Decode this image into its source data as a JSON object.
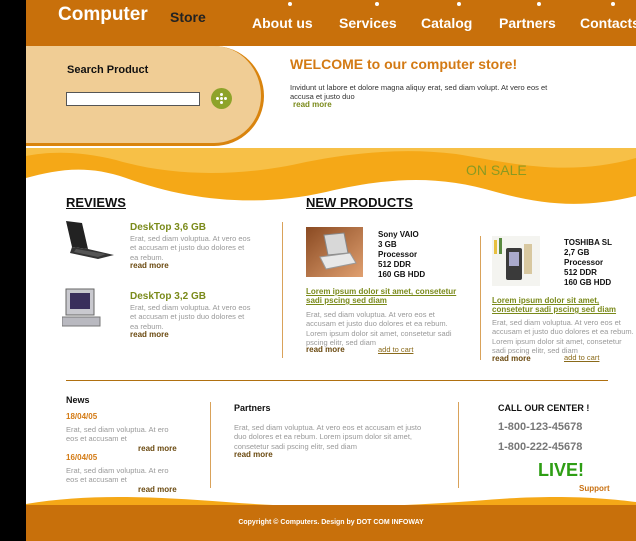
{
  "header": {
    "logo_main": "Computer",
    "logo_sub": "Store",
    "nav": [
      "About us",
      "Services",
      "Catalog",
      "Partners",
      "Contacts"
    ]
  },
  "search": {
    "label": "Search Product",
    "value": "",
    "go_icon": "arrow-go-icon"
  },
  "welcome": {
    "title": "WELCOME to our computer store!",
    "text": "Invidunt ut labore et dolore magna aliquy erat, sed diam volupt. At vero eos et accusa et justo duo",
    "read_more": "read more"
  },
  "on_sale": "ON SALE",
  "reviews": {
    "title": "REVIEWS",
    "items": [
      {
        "name": "DeskTop 3,6 GB",
        "text": "Erat, sed diam voluptua. At vero eos et accusam et justo duo dolores et ea rebum.",
        "link": "read more",
        "icon": "laptop-icon"
      },
      {
        "name": "DeskTop 3,2 GB",
        "text": "Erat, sed diam voluptua. At vero eos et accusam et justo duo dolores et ea rebum.",
        "link": "read more",
        "icon": "desktop-computer-icon"
      }
    ]
  },
  "new_products": {
    "title": "NEW PRODUCTS",
    "items": [
      {
        "specs": [
          "Sony VAIO",
          "3 GB",
          "Processor",
          "512 DDR",
          "160 GB HDD"
        ],
        "link_title": "Lorem ipsum dolor sit amet, consetetur sadi pscing sed diam",
        "text": "Erat, sed diam voluptua. At vero eos et accusam et justo duo dolores et ea rebum. Lorem ipsum dolor sit amet, consetetur sadi pscing elitr, sed diam",
        "read_more": "read more",
        "add_cart": "add to cart",
        "icon": "sony-vaio-laptop-icon"
      },
      {
        "specs": [
          "TOSHIBA SL",
          "2,7 GB",
          "Processor",
          "512 DDR",
          "160 GB HDD"
        ],
        "link_title": "Lorem ipsum dolor sit amet, consetetur sadi pscing sed diam",
        "text": "Erat, sed diam voluptua. At vero eos et accusam et justo duo dolores et ea rebum. Lorem ipsum dolor sit amet, consetetur sadi pscing elitr, sed diam",
        "read_more": "read more",
        "add_cart": "add to cart",
        "icon": "toshiba-pda-icon"
      }
    ]
  },
  "news": {
    "title": "News",
    "items": [
      {
        "date": "18/04/05",
        "text": "Erat, sed diam voluptua. At ero eos et accusam et",
        "link": "read more"
      },
      {
        "date": "16/04/05",
        "text": "Erat, sed diam voluptua. At ero eos et accusam et",
        "link": "read more"
      }
    ]
  },
  "partners": {
    "title": "Partners",
    "text": "Erat, sed diam voluptua. At vero eos et accusam et justo duo dolores et ea rebum. Lorem ipsum dolor sit amet, consetetur sadi pscing elitr, sed diam",
    "link": "read more"
  },
  "call_center": {
    "title": "CALL OUR CENTER !",
    "phones": [
      "1-800-123-45678",
      "1-800-222-45678"
    ],
    "live": "LIVE!",
    "support": "Support"
  },
  "footer": {
    "copyright": "Copyright © Computers. Design by DOT COM INFOWAY"
  },
  "colors": {
    "brand_orange": "#c8700b",
    "panel_tan": "#f0cd95",
    "accent_olive": "#7a8a1a",
    "live_green": "#2e9e14"
  }
}
